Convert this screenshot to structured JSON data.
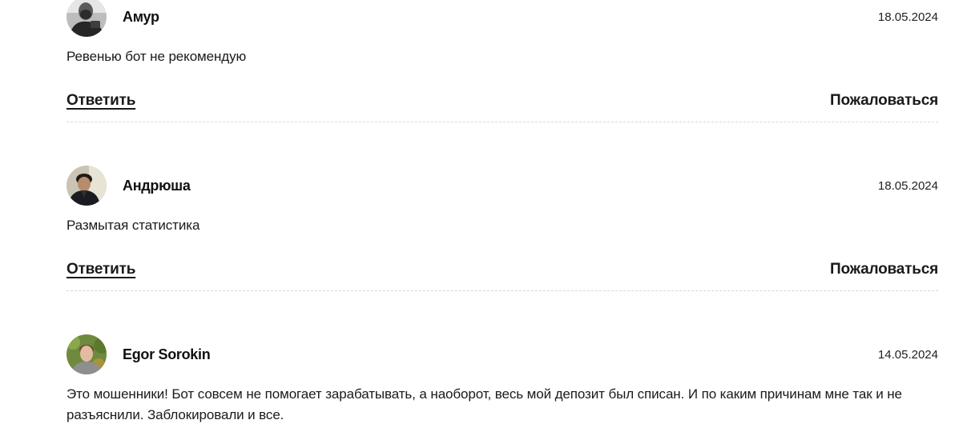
{
  "comments": [
    {
      "author": "Амур",
      "date": "18.05.2024",
      "text": "Ревенью бот не рекомендую",
      "reply_label": "Ответить",
      "report_label": "Пожаловаться",
      "avatar": "avatar-photo-man-dark-bw"
    },
    {
      "author": "Андрюша",
      "date": "18.05.2024",
      "text": "Размытая статистика",
      "reply_label": "Ответить",
      "report_label": "Пожаловаться",
      "avatar": "avatar-photo-man-dark-jacket"
    },
    {
      "author": "Egor Sorokin",
      "date": "14.05.2024",
      "text": "Это мошенники! Бот совсем не помогает зарабатывать, а наоборот, весь мой депозит был списан. И по каким причинам мне так и не разъяснили. Заблокировали и все.",
      "avatar": "avatar-photo-young-man-green-background"
    }
  ]
}
